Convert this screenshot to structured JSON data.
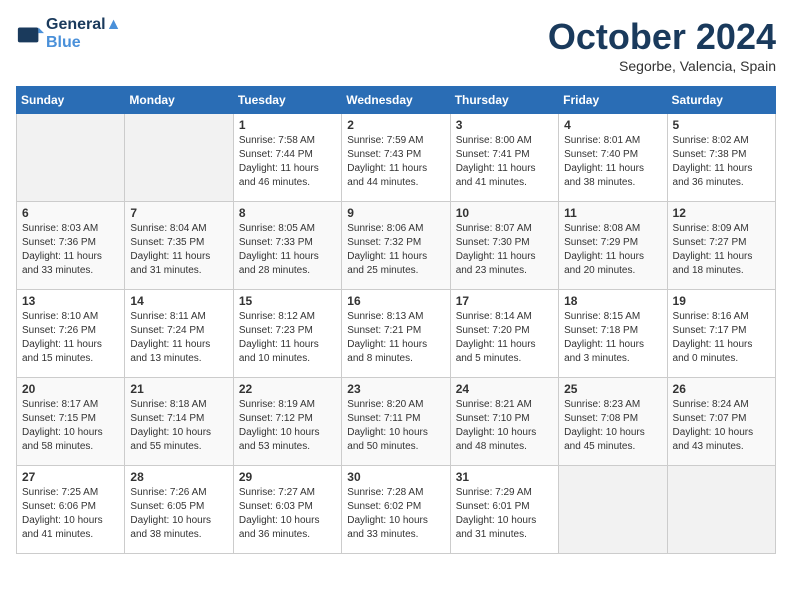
{
  "header": {
    "logo_line1": "General",
    "logo_line2": "Blue",
    "month": "October 2024",
    "location": "Segorbe, Valencia, Spain"
  },
  "days_of_week": [
    "Sunday",
    "Monday",
    "Tuesday",
    "Wednesday",
    "Thursday",
    "Friday",
    "Saturday"
  ],
  "weeks": [
    [
      {
        "day": "",
        "info": ""
      },
      {
        "day": "",
        "info": ""
      },
      {
        "day": "1",
        "info": "Sunrise: 7:58 AM\nSunset: 7:44 PM\nDaylight: 11 hours and 46 minutes."
      },
      {
        "day": "2",
        "info": "Sunrise: 7:59 AM\nSunset: 7:43 PM\nDaylight: 11 hours and 44 minutes."
      },
      {
        "day": "3",
        "info": "Sunrise: 8:00 AM\nSunset: 7:41 PM\nDaylight: 11 hours and 41 minutes."
      },
      {
        "day": "4",
        "info": "Sunrise: 8:01 AM\nSunset: 7:40 PM\nDaylight: 11 hours and 38 minutes."
      },
      {
        "day": "5",
        "info": "Sunrise: 8:02 AM\nSunset: 7:38 PM\nDaylight: 11 hours and 36 minutes."
      }
    ],
    [
      {
        "day": "6",
        "info": "Sunrise: 8:03 AM\nSunset: 7:36 PM\nDaylight: 11 hours and 33 minutes."
      },
      {
        "day": "7",
        "info": "Sunrise: 8:04 AM\nSunset: 7:35 PM\nDaylight: 11 hours and 31 minutes."
      },
      {
        "day": "8",
        "info": "Sunrise: 8:05 AM\nSunset: 7:33 PM\nDaylight: 11 hours and 28 minutes."
      },
      {
        "day": "9",
        "info": "Sunrise: 8:06 AM\nSunset: 7:32 PM\nDaylight: 11 hours and 25 minutes."
      },
      {
        "day": "10",
        "info": "Sunrise: 8:07 AM\nSunset: 7:30 PM\nDaylight: 11 hours and 23 minutes."
      },
      {
        "day": "11",
        "info": "Sunrise: 8:08 AM\nSunset: 7:29 PM\nDaylight: 11 hours and 20 minutes."
      },
      {
        "day": "12",
        "info": "Sunrise: 8:09 AM\nSunset: 7:27 PM\nDaylight: 11 hours and 18 minutes."
      }
    ],
    [
      {
        "day": "13",
        "info": "Sunrise: 8:10 AM\nSunset: 7:26 PM\nDaylight: 11 hours and 15 minutes."
      },
      {
        "day": "14",
        "info": "Sunrise: 8:11 AM\nSunset: 7:24 PM\nDaylight: 11 hours and 13 minutes."
      },
      {
        "day": "15",
        "info": "Sunrise: 8:12 AM\nSunset: 7:23 PM\nDaylight: 11 hours and 10 minutes."
      },
      {
        "day": "16",
        "info": "Sunrise: 8:13 AM\nSunset: 7:21 PM\nDaylight: 11 hours and 8 minutes."
      },
      {
        "day": "17",
        "info": "Sunrise: 8:14 AM\nSunset: 7:20 PM\nDaylight: 11 hours and 5 minutes."
      },
      {
        "day": "18",
        "info": "Sunrise: 8:15 AM\nSunset: 7:18 PM\nDaylight: 11 hours and 3 minutes."
      },
      {
        "day": "19",
        "info": "Sunrise: 8:16 AM\nSunset: 7:17 PM\nDaylight: 11 hours and 0 minutes."
      }
    ],
    [
      {
        "day": "20",
        "info": "Sunrise: 8:17 AM\nSunset: 7:15 PM\nDaylight: 10 hours and 58 minutes."
      },
      {
        "day": "21",
        "info": "Sunrise: 8:18 AM\nSunset: 7:14 PM\nDaylight: 10 hours and 55 minutes."
      },
      {
        "day": "22",
        "info": "Sunrise: 8:19 AM\nSunset: 7:12 PM\nDaylight: 10 hours and 53 minutes."
      },
      {
        "day": "23",
        "info": "Sunrise: 8:20 AM\nSunset: 7:11 PM\nDaylight: 10 hours and 50 minutes."
      },
      {
        "day": "24",
        "info": "Sunrise: 8:21 AM\nSunset: 7:10 PM\nDaylight: 10 hours and 48 minutes."
      },
      {
        "day": "25",
        "info": "Sunrise: 8:23 AM\nSunset: 7:08 PM\nDaylight: 10 hours and 45 minutes."
      },
      {
        "day": "26",
        "info": "Sunrise: 8:24 AM\nSunset: 7:07 PM\nDaylight: 10 hours and 43 minutes."
      }
    ],
    [
      {
        "day": "27",
        "info": "Sunrise: 7:25 AM\nSunset: 6:06 PM\nDaylight: 10 hours and 41 minutes."
      },
      {
        "day": "28",
        "info": "Sunrise: 7:26 AM\nSunset: 6:05 PM\nDaylight: 10 hours and 38 minutes."
      },
      {
        "day": "29",
        "info": "Sunrise: 7:27 AM\nSunset: 6:03 PM\nDaylight: 10 hours and 36 minutes."
      },
      {
        "day": "30",
        "info": "Sunrise: 7:28 AM\nSunset: 6:02 PM\nDaylight: 10 hours and 33 minutes."
      },
      {
        "day": "31",
        "info": "Sunrise: 7:29 AM\nSunset: 6:01 PM\nDaylight: 10 hours and 31 minutes."
      },
      {
        "day": "",
        "info": ""
      },
      {
        "day": "",
        "info": ""
      }
    ]
  ]
}
